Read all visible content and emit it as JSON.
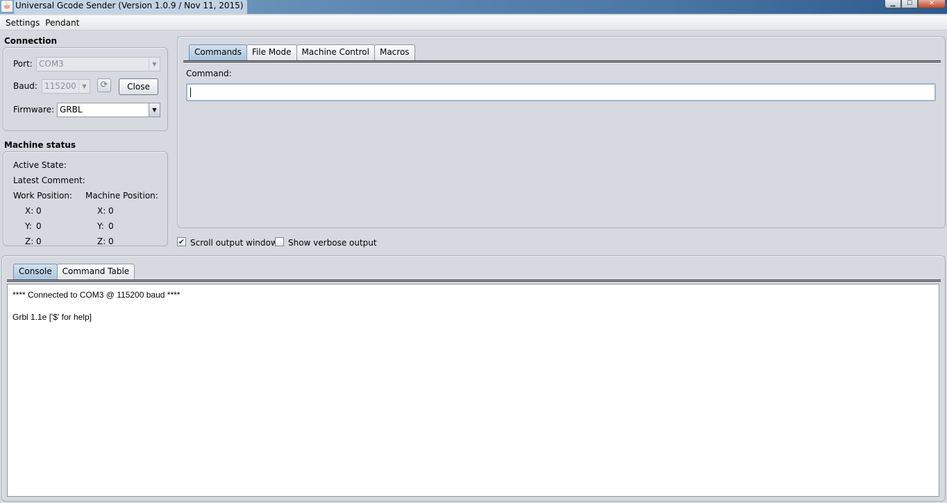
{
  "window": {
    "title": "Universal Gcode Sender (Version 1.0.9 / Nov 11, 2015)",
    "controls": {
      "minimize": "▁",
      "maximize": "☐",
      "close": "✕"
    }
  },
  "menu": {
    "items": [
      "Settings",
      "Pendant"
    ]
  },
  "connection": {
    "title": "Connection",
    "port_label": "Port:",
    "port_value": "COM3",
    "baud_label": "Baud:",
    "baud_value": "115200",
    "close_label": "Close",
    "firmware_label": "Firmware:",
    "firmware_value": "GRBL"
  },
  "machine_status": {
    "title": "Machine status",
    "active_state_label": "Active State:",
    "latest_comment_label": "Latest Comment:",
    "work_position_label": "Work Position:",
    "machine_position_label": "Machine Position:",
    "work": {
      "x_label": "X:",
      "x": "0",
      "y_label": "Y:",
      "y": "0",
      "z_label": "Z:",
      "z": "0"
    },
    "machine": {
      "x_label": "X:",
      "x": "0",
      "y_label": "Y:",
      "y": "0",
      "z_label": "Z:",
      "z": "0"
    }
  },
  "top_tabs": {
    "items": [
      "Commands",
      "File Mode",
      "Machine Control",
      "Macros"
    ],
    "active": "Commands"
  },
  "commands": {
    "label": "Command:",
    "value": ""
  },
  "options": {
    "scroll_output": {
      "label": "Scroll output window",
      "checked": true
    },
    "verbose_output": {
      "label": "Show verbose output",
      "checked": false
    }
  },
  "bottom_tabs": {
    "items": [
      "Console",
      "Command Table"
    ],
    "active": "Console"
  },
  "console": {
    "lines": [
      "**** Connected to COM3 @ 115200 baud ****",
      "Grbl 1.1e ['$' for help]"
    ]
  },
  "icons": {
    "app": "java-cup-icon",
    "refresh": "refresh-icon",
    "dropdown": "chevron-down-icon",
    "check": "checkmark-icon"
  }
}
